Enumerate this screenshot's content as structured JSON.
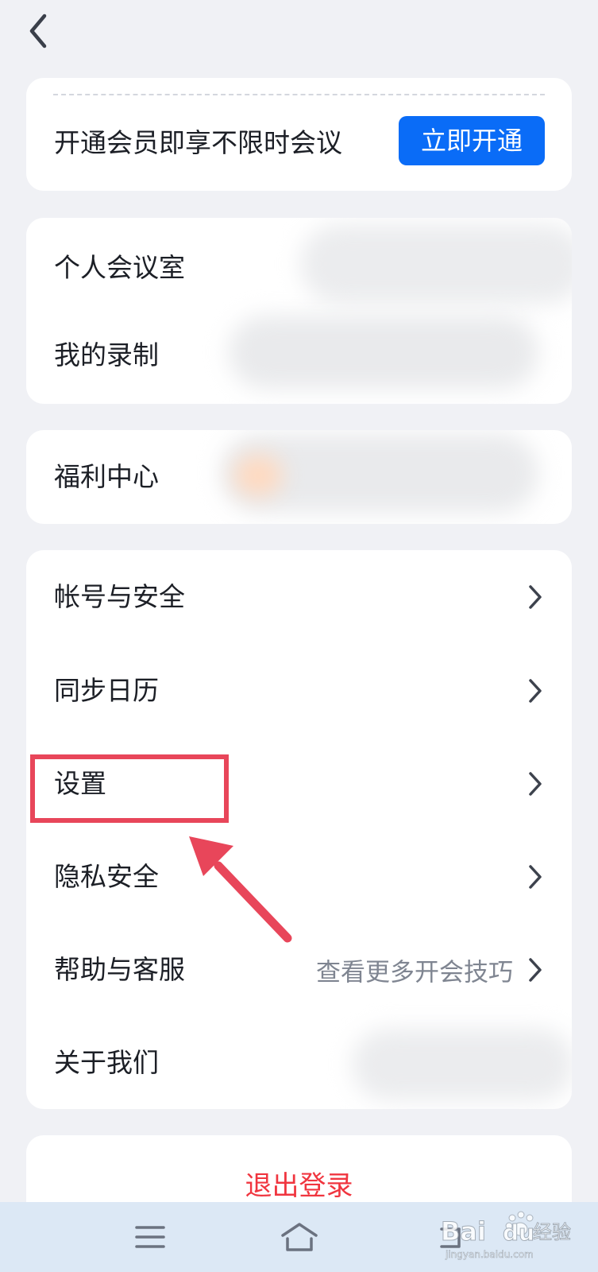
{
  "header": {
    "back_icon": "chevron-left-icon"
  },
  "vip_card": {
    "text": "开通会员即享不限时会议",
    "button_label": "立即开通",
    "accent": "#0a6cf7"
  },
  "room_card": {
    "items": [
      {
        "label": "个人会议室"
      },
      {
        "label": "我的录制"
      }
    ]
  },
  "welfare_card": {
    "items": [
      {
        "label": "福利中心"
      }
    ]
  },
  "settings_card": {
    "items": [
      {
        "label": "帐号与安全",
        "hint": ""
      },
      {
        "label": "同步日历",
        "hint": ""
      },
      {
        "label": "设置",
        "hint": ""
      },
      {
        "label": "隐私安全",
        "hint": ""
      },
      {
        "label": "帮助与客服",
        "hint": "查看更多开会技巧"
      },
      {
        "label": "关于我们",
        "hint": ""
      }
    ]
  },
  "logout": {
    "label": "退出登录",
    "color": "#f0353f"
  },
  "system_nav": {
    "icons": [
      "menu-icon",
      "home-icon",
      "back-nav-icon"
    ]
  },
  "annotation": {
    "color": "#e8465a"
  },
  "watermark": {
    "brand": "Bai",
    "brand2": "du",
    "cn": "经验",
    "url": "jingyan.baidu.com"
  }
}
